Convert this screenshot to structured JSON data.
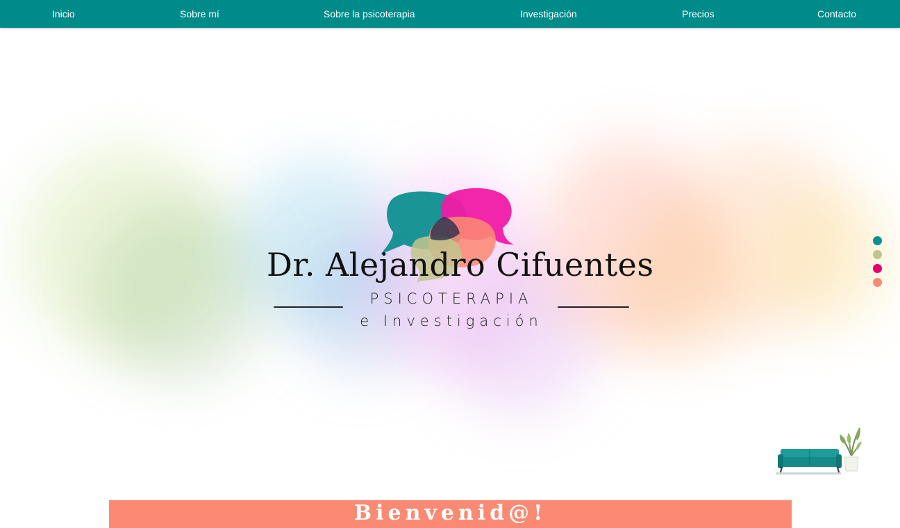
{
  "nav": {
    "items": [
      {
        "label": "Inicio"
      },
      {
        "label": "Sobre mí"
      },
      {
        "label": "Sobre la psicoterapia"
      },
      {
        "label": "Investigación"
      },
      {
        "label": "Precios"
      },
      {
        "label": "Contacto"
      }
    ]
  },
  "hero": {
    "name": "Dr. Alejandro Cifuentes",
    "subtitle_line1": "Psicoterapia",
    "subtitle_line2": "e Investigación"
  },
  "slider": {
    "dot_colors": [
      "#0f8f90",
      "#c2c48d",
      "#e5006e",
      "#fa8a73"
    ]
  },
  "welcome": {
    "title": "Bienvenid@!"
  },
  "colors": {
    "nav_bg": "#008b8b",
    "accent_teal": "#0f8f90",
    "accent_magenta": "#f01ba6",
    "accent_coral": "#fa8a73",
    "accent_olive": "#c2c48d"
  }
}
